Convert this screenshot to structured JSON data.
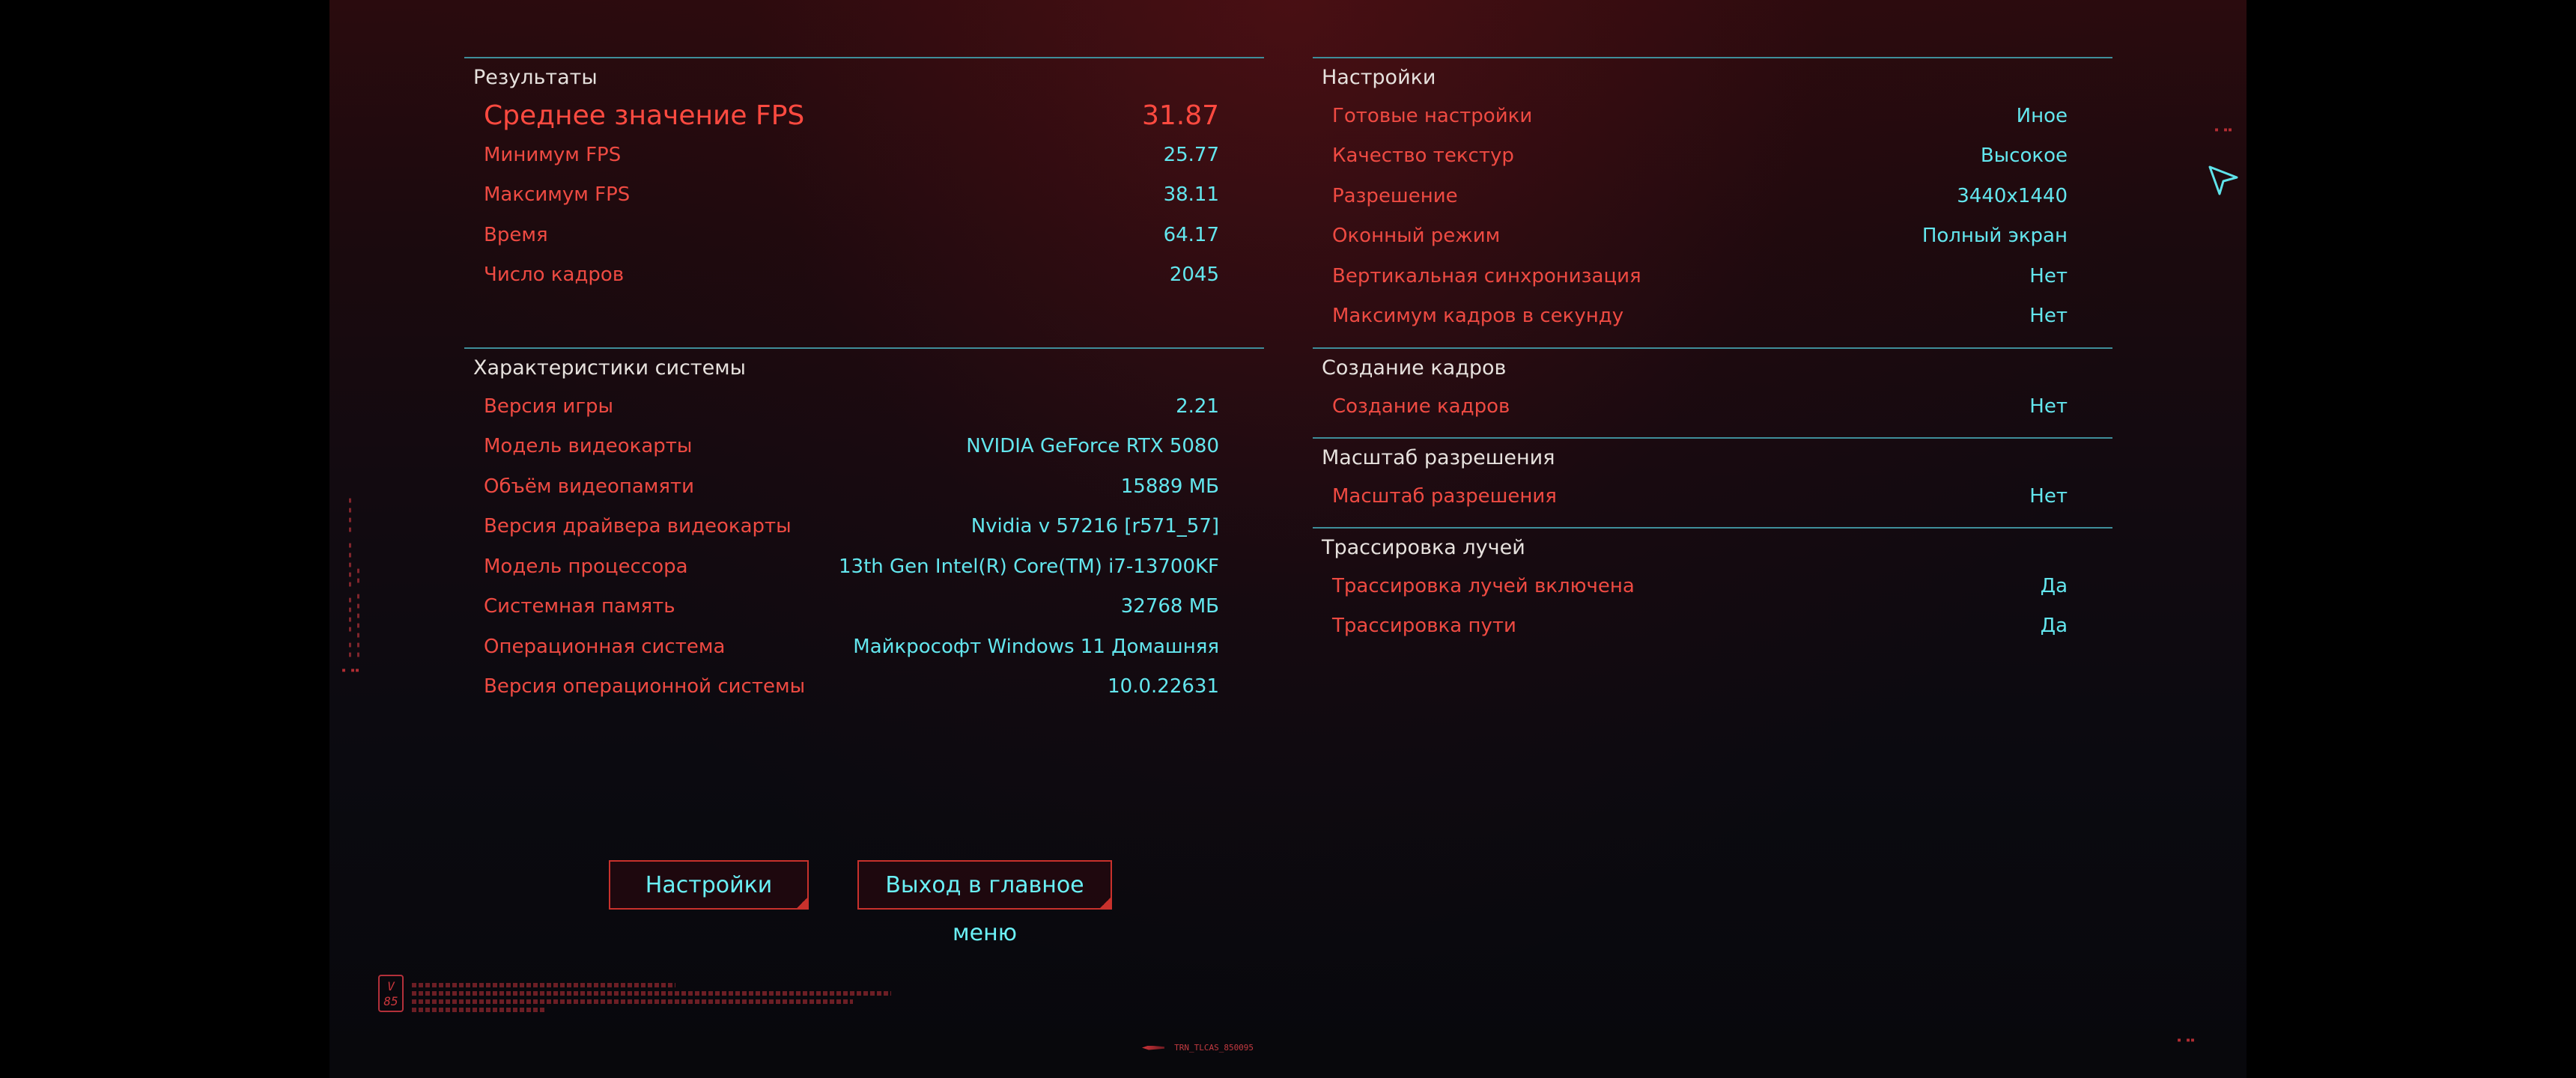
{
  "results": {
    "title": "Результаты",
    "main_label": "Среднее значение FPS",
    "main_value": "31.87",
    "rows": [
      {
        "label": "Минимум FPS",
        "value": "25.77"
      },
      {
        "label": "Максимум FPS",
        "value": "38.11"
      },
      {
        "label": "Время",
        "value": "64.17"
      },
      {
        "label": "Число кадров",
        "value": "2045"
      }
    ]
  },
  "system": {
    "title": "Характеристики системы",
    "rows": [
      {
        "label": "Версия игры",
        "value": "2.21"
      },
      {
        "label": "Модель видеокарты",
        "value": "NVIDIA GeForce RTX 5080"
      },
      {
        "label": "Объём видеопамяти",
        "value": "15889 МБ"
      },
      {
        "label": "Версия драйвера видеокарты",
        "value": "Nvidia v 57216 [r571_57]"
      },
      {
        "label": "Модель процессора",
        "value": "13th Gen Intel(R) Core(TM) i7-13700KF"
      },
      {
        "label": "Системная память",
        "value": "32768 МБ"
      },
      {
        "label": "Операционная система",
        "value": "Майкрософт Windows 11 Домашняя"
      },
      {
        "label": "Версия операционной системы",
        "value": "10.0.22631"
      }
    ]
  },
  "settings": {
    "title": "Настройки",
    "rows": [
      {
        "label": "Готовые настройки",
        "value": "Иное"
      },
      {
        "label": "Качество текстур",
        "value": "Высокое"
      },
      {
        "label": "Разрешение",
        "value": "3440x1440"
      },
      {
        "label": "Оконный режим",
        "value": "Полный экран"
      },
      {
        "label": "Вертикальная синхронизация",
        "value": "Нет"
      },
      {
        "label": "Максимум кадров в секунду",
        "value": "Нет"
      }
    ]
  },
  "frame_gen": {
    "title": "Создание кадров",
    "rows": [
      {
        "label": "Создание кадров",
        "value": "Нет"
      }
    ]
  },
  "res_scale": {
    "title": "Масштаб разрешения",
    "rows": [
      {
        "label": "Масштаб разрешения",
        "value": "Нет"
      }
    ]
  },
  "ray_tracing": {
    "title": "Трассировка лучей",
    "rows": [
      {
        "label": "Трассировка лучей включена",
        "value": "Да"
      },
      {
        "label": "Трассировка пути",
        "value": "Да"
      }
    ]
  },
  "buttons": {
    "settings": "Настройки",
    "exit": "Выход в главное меню"
  },
  "footer": {
    "code": "TRN_TLCAS_850095",
    "logo": "V 85"
  },
  "colors": {
    "label": "#ee4a42",
    "value": "#63e6ee",
    "accent_line": "#3f8e9a",
    "title": "#e6e1dd"
  }
}
